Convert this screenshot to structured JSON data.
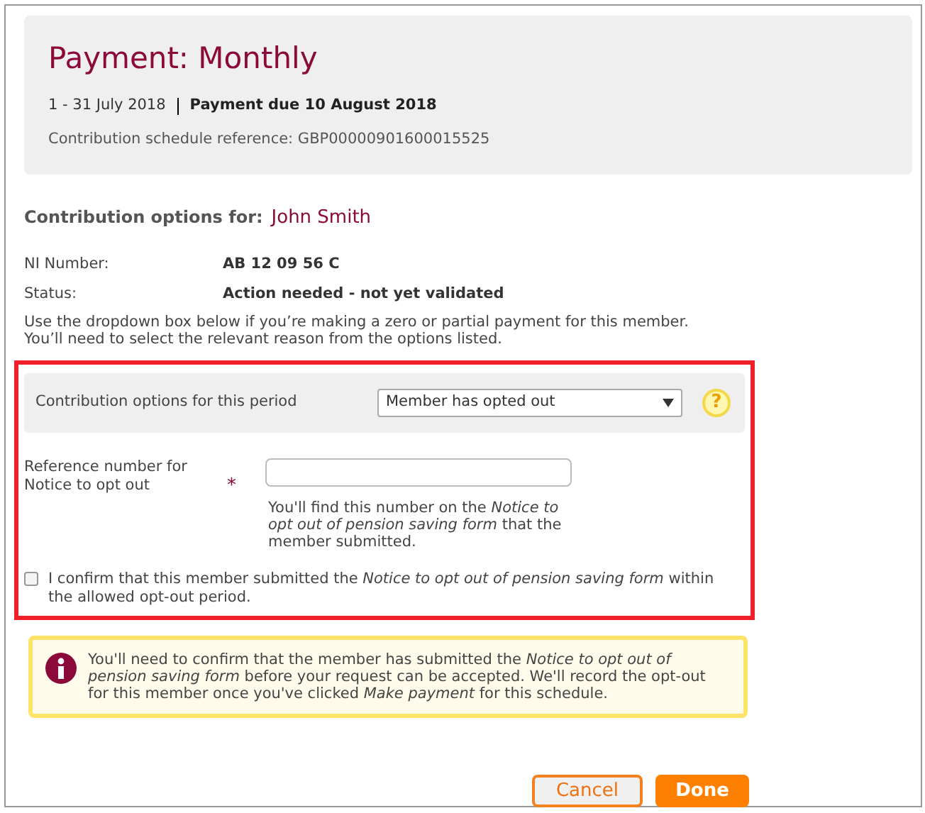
{
  "header": {
    "title": "Payment: Monthly",
    "period": "1 - 31 July 2018",
    "due": "Payment due 10 August 2018",
    "reference": "Contribution schedule reference: GBP00000901600015525"
  },
  "member": {
    "label": "Contribution options for:",
    "name": "John Smith"
  },
  "details": [
    {
      "label": "NI Number:",
      "value": "AB 12 09 56 C"
    },
    {
      "label": "Status:",
      "value": "Action needed - not yet validated"
    }
  ],
  "instructions": [
    "Use the dropdown box below if you’re making a zero or partial payment for this member.",
    "You’ll need to select the relevant reason from the options listed."
  ],
  "options": {
    "label": "Contribution options for this period",
    "value": "Member has opted out",
    "help": "?"
  },
  "reference_field": {
    "label": "Reference number for Notice to opt out",
    "required": "*",
    "hint": "You'll find this number on the *Notice to opt out of pension saving form* that the member submitted."
  },
  "confirm": {
    "checked": false,
    "text": "I confirm that this member submitted the *Notice to opt out of pension saving form* within the allowed opt-out period."
  },
  "notice": {
    "text": "You'll need to confirm that the member has submitted the *Notice to opt out of pension saving form* before your request can be accepted. We'll record the opt-out for this member once you've clicked *Make payment* for this schedule."
  },
  "buttons": [
    {
      "label": "Cancel",
      "kind": "secondary"
    },
    {
      "label": "Done",
      "kind": "primary"
    }
  ]
}
